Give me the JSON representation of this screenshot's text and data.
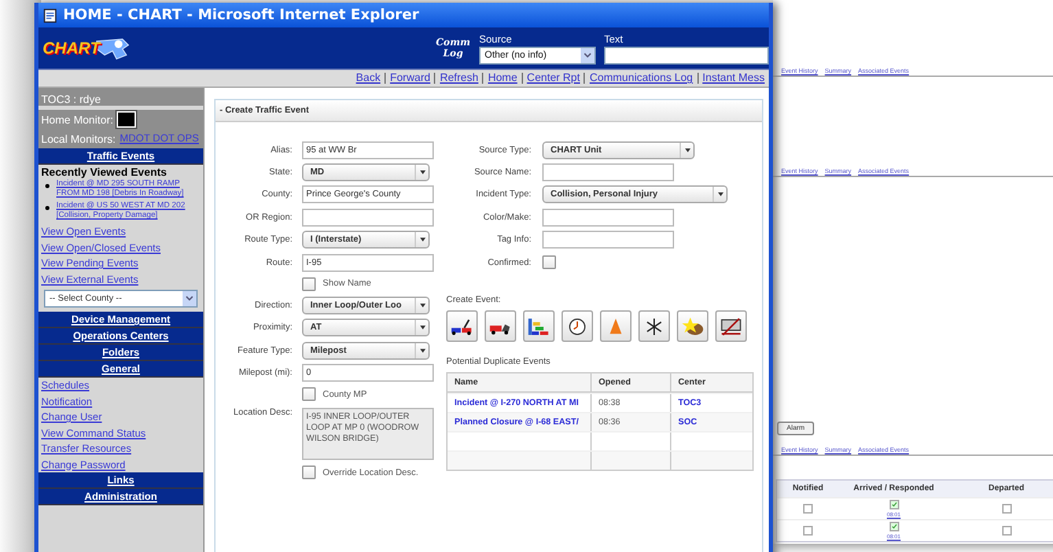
{
  "window": {
    "title": "HOME - CHART - Microsoft Internet Explorer"
  },
  "header": {
    "logo": "CHART",
    "comm_log": "Comm Log",
    "source_label": "Source",
    "source_value": "Other (no info)",
    "text_label": "Text"
  },
  "nav_links": [
    "Back",
    "Forward",
    "Refresh",
    "Home",
    "Center Rpt",
    "Communications Log",
    "Instant Mess"
  ],
  "sidebar": {
    "user": "TOC3 :  rdye",
    "home_monitor_label": "Home Monitor:",
    "local_monitors_label": "Local Monitors:",
    "local_monitors_link": "MDOT DOT OPS",
    "sections": [
      {
        "title": "Traffic Events",
        "recent_heading": "Recently Viewed Events",
        "recent": [
          "Incident @ MD 295 SOUTH RAMP FROM MD 198 [Debris In Roadway]",
          "Incident @ US 50 WEST AT MD 202 [Collision, Property Damage]"
        ],
        "links": [
          "View Open Events",
          "View Open/Closed Events",
          "View Pending Events",
          "View External Events"
        ],
        "county_select": "-- Select County --"
      },
      {
        "title": "Device Management"
      },
      {
        "title": "Operations Centers"
      },
      {
        "title": "Folders"
      },
      {
        "title": "General",
        "links": [
          "Schedules",
          "Notification",
          "Change User",
          "View Command Status",
          "Transfer Resources",
          "Change Password"
        ]
      },
      {
        "title": "Links"
      },
      {
        "title": "Administration"
      }
    ]
  },
  "form": {
    "title": "- Create Traffic Event",
    "left": [
      {
        "kind": "text",
        "label": "Alias:",
        "value": "95 at WW Br"
      },
      {
        "kind": "select",
        "label": "State:",
        "value": "MD"
      },
      {
        "kind": "text",
        "label": "County:",
        "value": "Prince George's County"
      },
      {
        "kind": "text",
        "label": "OR Region:"
      },
      {
        "kind": "select",
        "label": "Route Type:",
        "value": "I (Interstate)"
      },
      {
        "kind": "text",
        "label": "Route:",
        "value": "I-95"
      },
      {
        "kind": "checkbox",
        "label": "Show Name",
        "checked": false
      },
      {
        "kind": "select",
        "label": "Direction:",
        "value": "Inner Loop/Outer Loo"
      },
      {
        "kind": "select",
        "label": "Proximity:",
        "value": "AT"
      },
      {
        "kind": "select",
        "label": "Feature Type:",
        "value": "Milepost"
      },
      {
        "kind": "text",
        "label": "Milepost (mi):",
        "value": "0"
      },
      {
        "kind": "checkbox",
        "label": "County MP",
        "checked": false
      },
      {
        "kind": "textarea",
        "label": "Location Desc:",
        "value": "I-95 INNER LOOP/OUTER LOOP AT MP 0 (WOODROW WILSON BRIDGE)"
      },
      {
        "kind": "checkbox",
        "label": "Override Location Desc.",
        "checked": false
      }
    ],
    "right": [
      {
        "kind": "select",
        "label": "Source Type:",
        "value": "CHART Unit"
      },
      {
        "kind": "text",
        "label": "Source Name:"
      },
      {
        "kind": "wide_select",
        "label": "Incident Type:",
        "value": "Collision, Personal Injury"
      },
      {
        "kind": "text",
        "label": "Color/Make:"
      },
      {
        "kind": "text",
        "label": "Tag Info:"
      },
      {
        "kind": "labeled_checkbox",
        "label": "Confirmed:",
        "checked": false
      }
    ],
    "create_event_label": "Create Event:",
    "event_buttons": [
      {
        "kind": "tow"
      },
      {
        "kind": "wreck"
      },
      {
        "kind": "congestion"
      },
      {
        "kind": "clock"
      },
      {
        "kind": "cone"
      },
      {
        "kind": "snowflake"
      },
      {
        "kind": "star"
      },
      {
        "kind": "sign"
      }
    ],
    "duplicates": {
      "title": "Potential Duplicate Events",
      "columns": [
        "Name",
        "Opened",
        "Center"
      ],
      "rows": [
        {
          "name": "Incident @ I-270 NORTH AT MI",
          "opened": "08:38",
          "center": "TOC3"
        },
        {
          "name": "Planned Closure @ I-68 EAST/",
          "opened": "08:36",
          "center": "SOC"
        }
      ]
    }
  },
  "background": {
    "sections": [
      {
        "links": [
          "Event History",
          "Summary",
          "Associated Events"
        ]
      },
      {
        "links": [
          "Event History",
          "Summary",
          "Associated Events"
        ]
      },
      {
        "button": "Alarm",
        "links": [
          "Event History",
          "Summary",
          "Associated Events"
        ]
      }
    ],
    "table": {
      "columns": [
        "Notified",
        "Arrived / Responded",
        "Departed"
      ],
      "rows": [
        {
          "notified": false,
          "arrived": true,
          "arrived_time": "08:01",
          "departed": false
        },
        {
          "notified": false,
          "arrived": true,
          "arrived_time": "08:01",
          "departed": false
        }
      ]
    }
  }
}
